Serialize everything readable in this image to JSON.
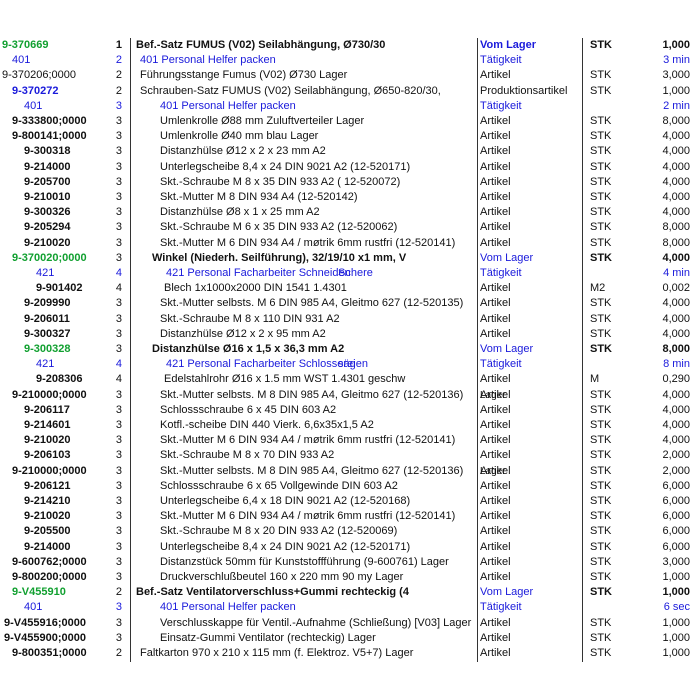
{
  "rows": [
    {
      "art": "9-370669",
      "lvl": "1",
      "desc": "Bef.-Satz FUMUS (V02) Seilabhängung, Ø730/30",
      "typ": "Vom Lager",
      "unit": "STK",
      "qty": "1,000",
      "style": "green",
      "art_indent": 0,
      "desc_indent": 0
    },
    {
      "art": "401",
      "lvl": "2",
      "desc": "401      Personal Helfer              packen",
      "typ": "Tätigkeit",
      "unit": "",
      "qty": "3 min",
      "style": "blue",
      "art_indent": 10,
      "desc_indent": 4
    },
    {
      "art": "9-370206;0000",
      "lvl": "2",
      "desc": "Führungsstange Fumus (V02) Ø730 Lager",
      "typ": "Artikel",
      "unit": "STK",
      "qty": "3,000",
      "style": "",
      "art_indent": 0,
      "desc_indent": 4
    },
    {
      "art": "9-370272",
      "lvl": "2",
      "desc": "Schrauben-Satz FUMUS (V02) Seilabhängung, Ø650-820/30,",
      "typ": "Produktionsartikel",
      "unit": "STK",
      "qty": "1,000",
      "style": "blueart",
      "art_indent": 10,
      "desc_indent": 4
    },
    {
      "art": "401",
      "lvl": "3",
      "desc": "401      Personal Helfer              packen",
      "typ": "Tätigkeit",
      "unit": "",
      "qty": "2 min",
      "style": "blue",
      "art_indent": 22,
      "desc_indent": 24
    },
    {
      "art": "9-333800;0000",
      "lvl": "3",
      "desc": "Umlenkrolle Ø88 mm Zuluftverteiler Lager",
      "typ": "Artikel",
      "unit": "STK",
      "qty": "8,000",
      "style": "boldart",
      "art_indent": 10,
      "desc_indent": 24
    },
    {
      "art": "9-800141;0000",
      "lvl": "3",
      "desc": "Umlenkrolle Ø40 mm blau Lager",
      "typ": "Artikel",
      "unit": "STK",
      "qty": "4,000",
      "style": "boldart",
      "art_indent": 10,
      "desc_indent": 24
    },
    {
      "art": "9-300318",
      "lvl": "3",
      "desc": "Distanzhülse Ø12 x 2 x 23 mm A2",
      "typ": "Artikel",
      "unit": "STK",
      "qty": "4,000",
      "style": "boldart",
      "art_indent": 22,
      "desc_indent": 24
    },
    {
      "art": "9-214000",
      "lvl": "3",
      "desc": "Unterlegscheibe 8,4 x 24 DIN 9021 A2 (12-520171)",
      "typ": "Artikel",
      "unit": "STK",
      "qty": "4,000",
      "style": "boldart",
      "art_indent": 22,
      "desc_indent": 24
    },
    {
      "art": "9-205700",
      "lvl": "3",
      "desc": "Skt.-Schraube M 8 x 35 DIN 933 A2 ( 12-520072)",
      "typ": "Artikel",
      "unit": "STK",
      "qty": "4,000",
      "style": "boldart",
      "art_indent": 22,
      "desc_indent": 24
    },
    {
      "art": "9-210010",
      "lvl": "3",
      "desc": "Skt.-Mutter M 8 DIN 934 A4 (12-520142)",
      "typ": "Artikel",
      "unit": "STK",
      "qty": "4,000",
      "style": "boldart",
      "art_indent": 22,
      "desc_indent": 24
    },
    {
      "art": "9-300326",
      "lvl": "3",
      "desc": "Distanzhülse Ø8 x 1 x 25 mm A2",
      "typ": "Artikel",
      "unit": "STK",
      "qty": "4,000",
      "style": "boldart",
      "art_indent": 22,
      "desc_indent": 24
    },
    {
      "art": "9-205294",
      "lvl": "3",
      "desc": "Skt.-Schraube M 6 x 35 DIN 933 A2 (12-520062)",
      "typ": "Artikel",
      "unit": "STK",
      "qty": "8,000",
      "style": "boldart",
      "art_indent": 22,
      "desc_indent": 24
    },
    {
      "art": "9-210020",
      "lvl": "3",
      "desc": "Skt.-Mutter M 6 DIN 934 A4 / møtrik 6mm rustfri (12-520141)",
      "typ": "Artikel",
      "unit": "STK",
      "qty": "8,000",
      "style": "boldart",
      "art_indent": 22,
      "desc_indent": 24
    },
    {
      "art": "9-370020;0000",
      "lvl": "3",
      "desc": "Winkel (Niederh. Seilführung), 32/19/10 x1 mm, V",
      "typ": "Vom Lager",
      "unit": "STK",
      "qty": "4,000",
      "style": "greenbold",
      "art_indent": 10,
      "desc_indent": 16
    },
    {
      "art": "421",
      "lvl": "4",
      "desc": "421      Personal Facharbeiter Schneiden",
      "desc_overlay": "Schere",
      "typ": "Tätigkeit",
      "unit": "",
      "qty": "4 min",
      "style": "blue",
      "art_indent": 34,
      "desc_indent": 30
    },
    {
      "art": "9-901402",
      "lvl": "4",
      "desc": "Blech 1x1000x2000 DIN 1541 1.4301",
      "typ": "Artikel",
      "unit": "M2",
      "qty": "0,002",
      "style": "boldart",
      "art_indent": 34,
      "desc_indent": 28
    },
    {
      "art": "9-209990",
      "lvl": "3",
      "desc": "Skt.-Mutter selbsts. M 6 DIN 985 A4, Gleitmo 627 (12-520135)",
      "typ": "Artikel",
      "unit": "STK",
      "qty": "4,000",
      "style": "boldart",
      "art_indent": 22,
      "desc_indent": 24
    },
    {
      "art": "9-206011",
      "lvl": "3",
      "desc": "Skt.-Schraube M 8 x 110 DIN 931 A2",
      "typ": "Artikel",
      "unit": "STK",
      "qty": "4,000",
      "style": "boldart",
      "art_indent": 22,
      "desc_indent": 24
    },
    {
      "art": "9-300327",
      "lvl": "3",
      "desc": "Distanzhülse Ø12 x 2 x 95 mm A2",
      "typ": "Artikel",
      "unit": "STK",
      "qty": "4,000",
      "style": "boldart",
      "art_indent": 22,
      "desc_indent": 24
    },
    {
      "art": "9-300328",
      "lvl": "3",
      "desc": "Distanzhülse Ø16 x 1,5 x 36,3 mm A2",
      "typ": "Vom Lager",
      "unit": "STK",
      "qty": "8,000",
      "style": "greenbold",
      "art_indent": 22,
      "desc_indent": 16
    },
    {
      "art": "421",
      "lvl": "4",
      "desc": "421      Personal Facharbeiter Schlosserei",
      "desc_overlay": "sägen",
      "typ": "Tätigkeit",
      "unit": "",
      "qty": "8 min",
      "style": "blue",
      "art_indent": 34,
      "desc_indent": 30
    },
    {
      "art": "9-208306",
      "lvl": "4",
      "desc": "Edelstahlrohr Ø16 x 1.5 mm WST 1.4301 geschw",
      "typ": "Artikel",
      "unit": "M",
      "qty": "0,290",
      "style": "boldart",
      "art_indent": 34,
      "desc_indent": 28
    },
    {
      "art": "9-210000;0000",
      "lvl": "3",
      "desc": "Skt.-Mutter selbsts. M 8 DIN 985 A4, Gleitmo 627 (12-520136)",
      "typ": "Artikel",
      "typ_overlay": "Lager",
      "unit": "STK",
      "qty": "4,000",
      "style": "boldart",
      "art_indent": 10,
      "desc_indent": 24
    },
    {
      "art": "9-206117",
      "lvl": "3",
      "desc": "Schlossschraube 6 x 45 DIN 603 A2",
      "typ": "Artikel",
      "unit": "STK",
      "qty": "4,000",
      "style": "boldart",
      "art_indent": 22,
      "desc_indent": 24
    },
    {
      "art": "9-214601",
      "lvl": "3",
      "desc": "Kotfl.-scheibe DIN 440 Vierk. 6,6x35x1,5  A2",
      "typ": "Artikel",
      "unit": "STK",
      "qty": "4,000",
      "style": "boldart",
      "art_indent": 22,
      "desc_indent": 24
    },
    {
      "art": "9-210020",
      "lvl": "3",
      "desc": "Skt.-Mutter M 6 DIN 934 A4 / møtrik 6mm rustfri (12-520141)",
      "typ": "Artikel",
      "unit": "STK",
      "qty": "4,000",
      "style": "boldart",
      "art_indent": 22,
      "desc_indent": 24
    },
    {
      "art": "9-206103",
      "lvl": "3",
      "desc": "Skt.-Schraube M 8 x 70 DIN 933 A2",
      "typ": "Artikel",
      "unit": "STK",
      "qty": "2,000",
      "style": "boldart",
      "art_indent": 22,
      "desc_indent": 24
    },
    {
      "art": "9-210000;0000",
      "lvl": "3",
      "desc": "Skt.-Mutter selbsts. M 8 DIN 985 A4, Gleitmo 627 (12-520136)",
      "typ": "Artikel",
      "typ_overlay": "Lager",
      "unit": "STK",
      "qty": "2,000",
      "style": "boldart",
      "art_indent": 10,
      "desc_indent": 24
    },
    {
      "art": "9-206121",
      "lvl": "3",
      "desc": "Schlossschraube 6 x 65 Vollgewinde DIN 603 A2",
      "typ": "Artikel",
      "unit": "STK",
      "qty": "6,000",
      "style": "boldart",
      "art_indent": 22,
      "desc_indent": 24
    },
    {
      "art": "9-214210",
      "lvl": "3",
      "desc": "Unterlegscheibe 6,4 x 18 DIN 9021 A2 (12-520168)",
      "typ": "Artikel",
      "unit": "STK",
      "qty": "6,000",
      "style": "boldart",
      "art_indent": 22,
      "desc_indent": 24
    },
    {
      "art": "9-210020",
      "lvl": "3",
      "desc": "Skt.-Mutter M 6 DIN 934 A4 / møtrik 6mm rustfri (12-520141)",
      "typ": "Artikel",
      "unit": "STK",
      "qty": "6,000",
      "style": "boldart",
      "art_indent": 22,
      "desc_indent": 24
    },
    {
      "art": "9-205500",
      "lvl": "3",
      "desc": "Skt.-Schraube M 8 x 20 DIN 933 A2 (12-520069)",
      "typ": "Artikel",
      "unit": "STK",
      "qty": "6,000",
      "style": "boldart",
      "art_indent": 22,
      "desc_indent": 24
    },
    {
      "art": "9-214000",
      "lvl": "3",
      "desc": "Unterlegscheibe 8,4 x 24 DIN 9021 A2 (12-520171)",
      "typ": "Artikel",
      "unit": "STK",
      "qty": "6,000",
      "style": "boldart",
      "art_indent": 22,
      "desc_indent": 24
    },
    {
      "art": "9-600762;0000",
      "lvl": "3",
      "desc": "Distanzstück 50mm für Kunststoffführung (9-600761) Lager",
      "typ": "Artikel",
      "unit": "STK",
      "qty": "3,000",
      "style": "boldart",
      "art_indent": 10,
      "desc_indent": 24
    },
    {
      "art": "9-800200;0000",
      "lvl": "3",
      "desc": "Druckverschlußbeutel 160 x 220 mm 90 my Lager",
      "typ": "Artikel",
      "unit": "STK",
      "qty": "1,000",
      "style": "boldart",
      "art_indent": 10,
      "desc_indent": 24
    },
    {
      "art": "9-V455910",
      "lvl": "2",
      "desc": "Bef.-Satz Ventilatorverschluss+Gummi rechteckig (4",
      "typ": "Vom Lager",
      "unit": "STK",
      "qty": "1,000",
      "style": "greenbold",
      "art_indent": 10,
      "desc_indent": 0
    },
    {
      "art": "401",
      "lvl": "3",
      "desc": "401      Personal Helfer              packen",
      "typ": "Tätigkeit",
      "unit": "",
      "qty": "6 sec",
      "style": "blue",
      "art_indent": 22,
      "desc_indent": 24
    },
    {
      "art": "9-V455916;0000",
      "lvl": "3",
      "desc": "Verschlusskappe für Ventil.-Aufnahme (Schließung) [V03] Lager",
      "typ": "Artikel",
      "unit": "STK",
      "qty": "1,000",
      "style": "boldart",
      "art_indent": 2,
      "desc_indent": 24
    },
    {
      "art": "9-V455900;0000",
      "lvl": "3",
      "desc": "Einsatz-Gummi Ventilator (rechteckig) Lager",
      "typ": "Artikel",
      "unit": "STK",
      "qty": "1,000",
      "style": "boldart",
      "art_indent": 2,
      "desc_indent": 24
    },
    {
      "art": "9-800351;0000",
      "lvl": "2",
      "desc": "Faltkarton 970 x 210 x 115 mm (f. Elektroz. V5+7) Lager",
      "typ": "Artikel",
      "unit": "STK",
      "qty": "1,000",
      "style": "boldart",
      "art_indent": 10,
      "desc_indent": 4
    }
  ]
}
